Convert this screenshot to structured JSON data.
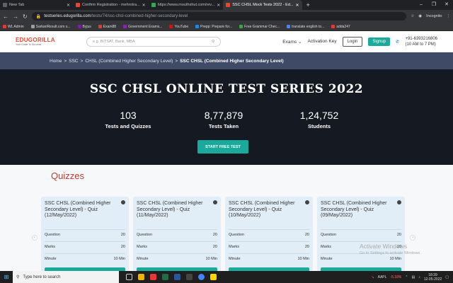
{
  "browser": {
    "tabs": [
      {
        "title": "New Tab",
        "color": "#5f6368",
        "active": false
      },
      {
        "title": "Confirm Registration - mehrotra...",
        "color": "#ea4335",
        "active": false
      },
      {
        "title": "https://www.mouthshut.com/rev...",
        "color": "#34a853",
        "active": false
      },
      {
        "title": "SSC CHSL Mock Tests 2022 - Ed...",
        "color": "#e9462f",
        "active": true
      }
    ],
    "url_domain": "testseries.edugorilla.com",
    "url_path": "/tests/74/ssc-chsl-combined-higher-secondary-level",
    "profile": "Incognito",
    "bookmarks": [
      {
        "label": "WL Admin",
        "color": "#e53935"
      },
      {
        "label": "SarkariResult.com s...",
        "color": "#9e9e9e"
      },
      {
        "label": "Byjus",
        "color": "#7b1fa2"
      },
      {
        "label": "Exam88",
        "color": "#e53935"
      },
      {
        "label": "Government Exams...",
        "color": "#8e24aa"
      },
      {
        "label": "YouTube",
        "color": "#ff0000"
      },
      {
        "label": "Prepp: Prepare for...",
        "color": "#1e88e5"
      },
      {
        "label": "Free Grammar Chec...",
        "color": "#43a047"
      },
      {
        "label": "translate english to...",
        "color": "#4285f4"
      },
      {
        "label": "adda247",
        "color": "#e53935"
      }
    ]
  },
  "header": {
    "logo_name": "EDUGORILLA",
    "logo_tagline": "Your Guide To Success",
    "search_placeholder": "e.g. BITSAT, Bank, MBA",
    "exams_label": "Exams",
    "activation_label": "Activation Key",
    "login_label": "Login",
    "signup_label": "Signup",
    "phone": "+91-6393216806",
    "hours": "(10 AM to 7 PM)"
  },
  "breadcrumb": {
    "home": "Home",
    "ssc": "SSC",
    "chsl": "CHSL (Combined Higher Secondary Level)",
    "current": "SSC CHSL (Combined Higher Secondary Level)"
  },
  "hero": {
    "title": "SSC CHSL ONLINE TEST SERIES 2022",
    "stats": [
      {
        "value": "103",
        "label": "Tests and Quizzes"
      },
      {
        "value": "8,77,879",
        "label": "Tests Taken"
      },
      {
        "value": "1,24,752",
        "label": "Students"
      }
    ],
    "cta_label": "START FREE TEST"
  },
  "quizzes": {
    "heading": "Quizzes",
    "row_labels": {
      "question": "Question",
      "marks": "Marks",
      "minute": "Minute"
    },
    "cards": [
      {
        "title": "SSC CHSL (Combined Higher Secondary Level) - Quiz (12/May/2022)",
        "question": "20",
        "marks": "20",
        "minute": "10 Min"
      },
      {
        "title": "SSC CHSL (Combined Higher Secondary Level) - Quiz (11/May/2022)",
        "question": "20",
        "marks": "20",
        "minute": "10 Min"
      },
      {
        "title": "SSC CHSL (Combined Higher Secondary Level) - Quiz (10/May/2022)",
        "question": "20",
        "marks": "20",
        "minute": "10 Min"
      },
      {
        "title": "SSC CHSL (Combined Higher Secondary Level) - Quiz (09/May/2022)",
        "question": "20",
        "marks": "20",
        "minute": "10 Min"
      }
    ]
  },
  "watermark": {
    "line1": "Activate Windows",
    "line2": "Go to Settings to activate Windows."
  },
  "taskbar": {
    "search_placeholder": "Type here to search",
    "stock_symbol": "AAPL",
    "stock_change": "-5.18%",
    "time": "18:39",
    "date": "12-05-2022"
  }
}
